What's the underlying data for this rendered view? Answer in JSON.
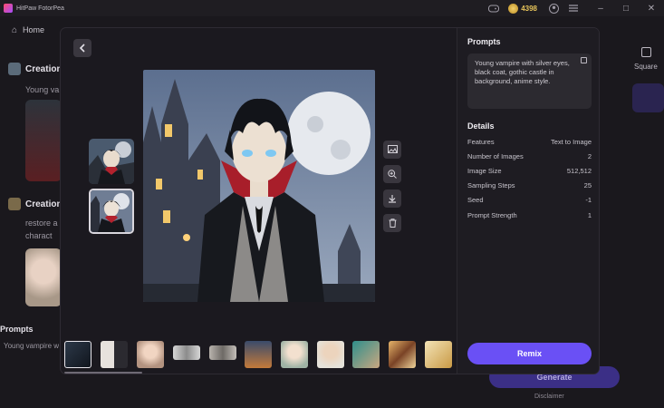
{
  "app": {
    "title": "HitPaw FotorPea"
  },
  "titlebar": {
    "coins": "4398",
    "icons": [
      "gamepad-icon",
      "coin-icon",
      "user-icon",
      "menu-icon",
      "minimize-icon",
      "maximize-icon",
      "close-icon"
    ]
  },
  "nav": {
    "home_label": "Home",
    "home_icon": "home-icon"
  },
  "background": {
    "creation1_label": "Creation",
    "creation1_text": "Young va",
    "creation2_label": "Creation",
    "creation2_text1": "restore a",
    "creation2_text2": "charact",
    "prompts_label": "Prompts",
    "prompt_text": "Young vampire w",
    "square_label": "Square",
    "generate_label": "Generate",
    "disclaimer": "Disclaimer"
  },
  "modal": {
    "back_icon": "chevron-left-icon",
    "tools": [
      "image-edit-icon",
      "zoom-in-icon",
      "download-icon",
      "delete-icon"
    ]
  },
  "details": {
    "prompts_title": "Prompts",
    "prompt_text": "Young vampire with silver eyes, black coat, gothic castle in background, anime style.",
    "details_title": "Details",
    "rows": [
      {
        "key": "Features",
        "value": "Text to Image"
      },
      {
        "key": "Number of Images",
        "value": "2"
      },
      {
        "key": "Image Size",
        "value": "512,512"
      },
      {
        "key": "Sampling Steps",
        "value": "25"
      },
      {
        "key": "Seed",
        "value": "-1"
      },
      {
        "key": "Prompt Strength",
        "value": "1"
      }
    ],
    "remix_label": "Remix"
  },
  "colors": {
    "accent": "#6a50f5",
    "panel": "#1e1c22",
    "background": "#1a181d"
  }
}
